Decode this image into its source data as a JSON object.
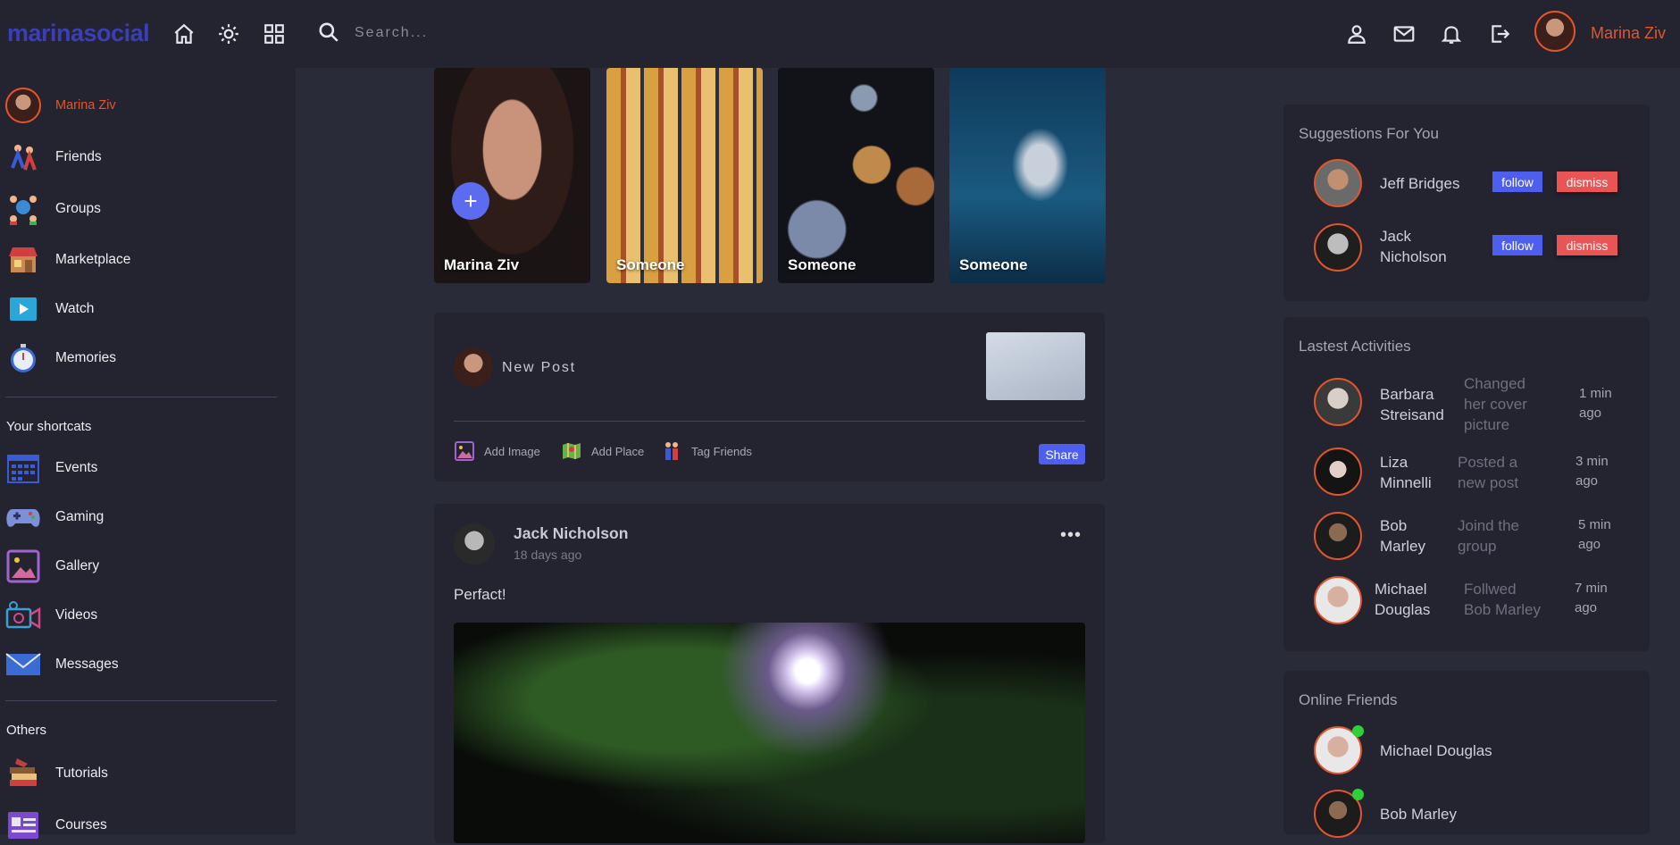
{
  "app": {
    "logo": "marinasocial"
  },
  "search": {
    "placeholder": "Search..."
  },
  "user": {
    "name": "Marina Ziv"
  },
  "sidebar": {
    "items": [
      {
        "label": "Marina Ziv"
      },
      {
        "label": "Friends"
      },
      {
        "label": "Groups"
      },
      {
        "label": "Marketplace"
      },
      {
        "label": "Watch"
      },
      {
        "label": "Memories"
      }
    ],
    "shortcuts_title": "Your shortcats",
    "shortcuts": [
      {
        "label": "Events"
      },
      {
        "label": "Gaming"
      },
      {
        "label": "Gallery"
      },
      {
        "label": "Videos"
      },
      {
        "label": "Messages"
      }
    ],
    "others_title": "Others",
    "others": [
      {
        "label": "Tutorials"
      },
      {
        "label": "Courses"
      }
    ]
  },
  "stories": [
    {
      "name": "Marina Ziv"
    },
    {
      "name": "Someone"
    },
    {
      "name": "Someone"
    },
    {
      "name": "Someone"
    }
  ],
  "new_post": {
    "label": "New Post",
    "add_image": "Add Image",
    "add_place": "Add Place",
    "tag_friends": "Tag Friends",
    "share": "Share"
  },
  "post": {
    "author": "Jack Nicholson",
    "time": "18 days ago",
    "text": "Perfact!",
    "more": "•••"
  },
  "suggestions": {
    "title": "Suggestions For You",
    "follow_label": "follow",
    "dismiss_label": "dismiss",
    "people": [
      {
        "name": "Jeff Bridges"
      },
      {
        "name_line1": "Jack",
        "name_line2": "Nicholson"
      }
    ]
  },
  "activities": {
    "title": "Lastest Activities",
    "items": [
      {
        "name1": "Barbara",
        "name2": "Streisand",
        "d1": "Changed",
        "d2": "her cover",
        "d3": "picture",
        "t1": "1 min",
        "t2": "ago"
      },
      {
        "name1": "Liza",
        "name2": "Minnelli",
        "d1": "Posted a",
        "d2": "new post",
        "t1": "3 min",
        "t2": "ago"
      },
      {
        "name1": "Bob",
        "name2": "Marley",
        "d1": "Joind the",
        "d2": "group",
        "t1": "5 min",
        "t2": "ago"
      },
      {
        "name1": "Michael",
        "name2": "Douglas",
        "d1": "Follwed",
        "d2": "Bob Marley",
        "t1": "7 min",
        "t2": "ago"
      }
    ]
  },
  "online": {
    "title": "Online Friends",
    "friends": [
      {
        "name": "Michael Douglas"
      },
      {
        "name": "Bob Marley"
      }
    ]
  },
  "colors": {
    "accent": "#4e5ff0",
    "brand": "#3a3fb8",
    "username": "#e2562b",
    "dismiss": "#e95454",
    "online": "#2fcf3a"
  }
}
